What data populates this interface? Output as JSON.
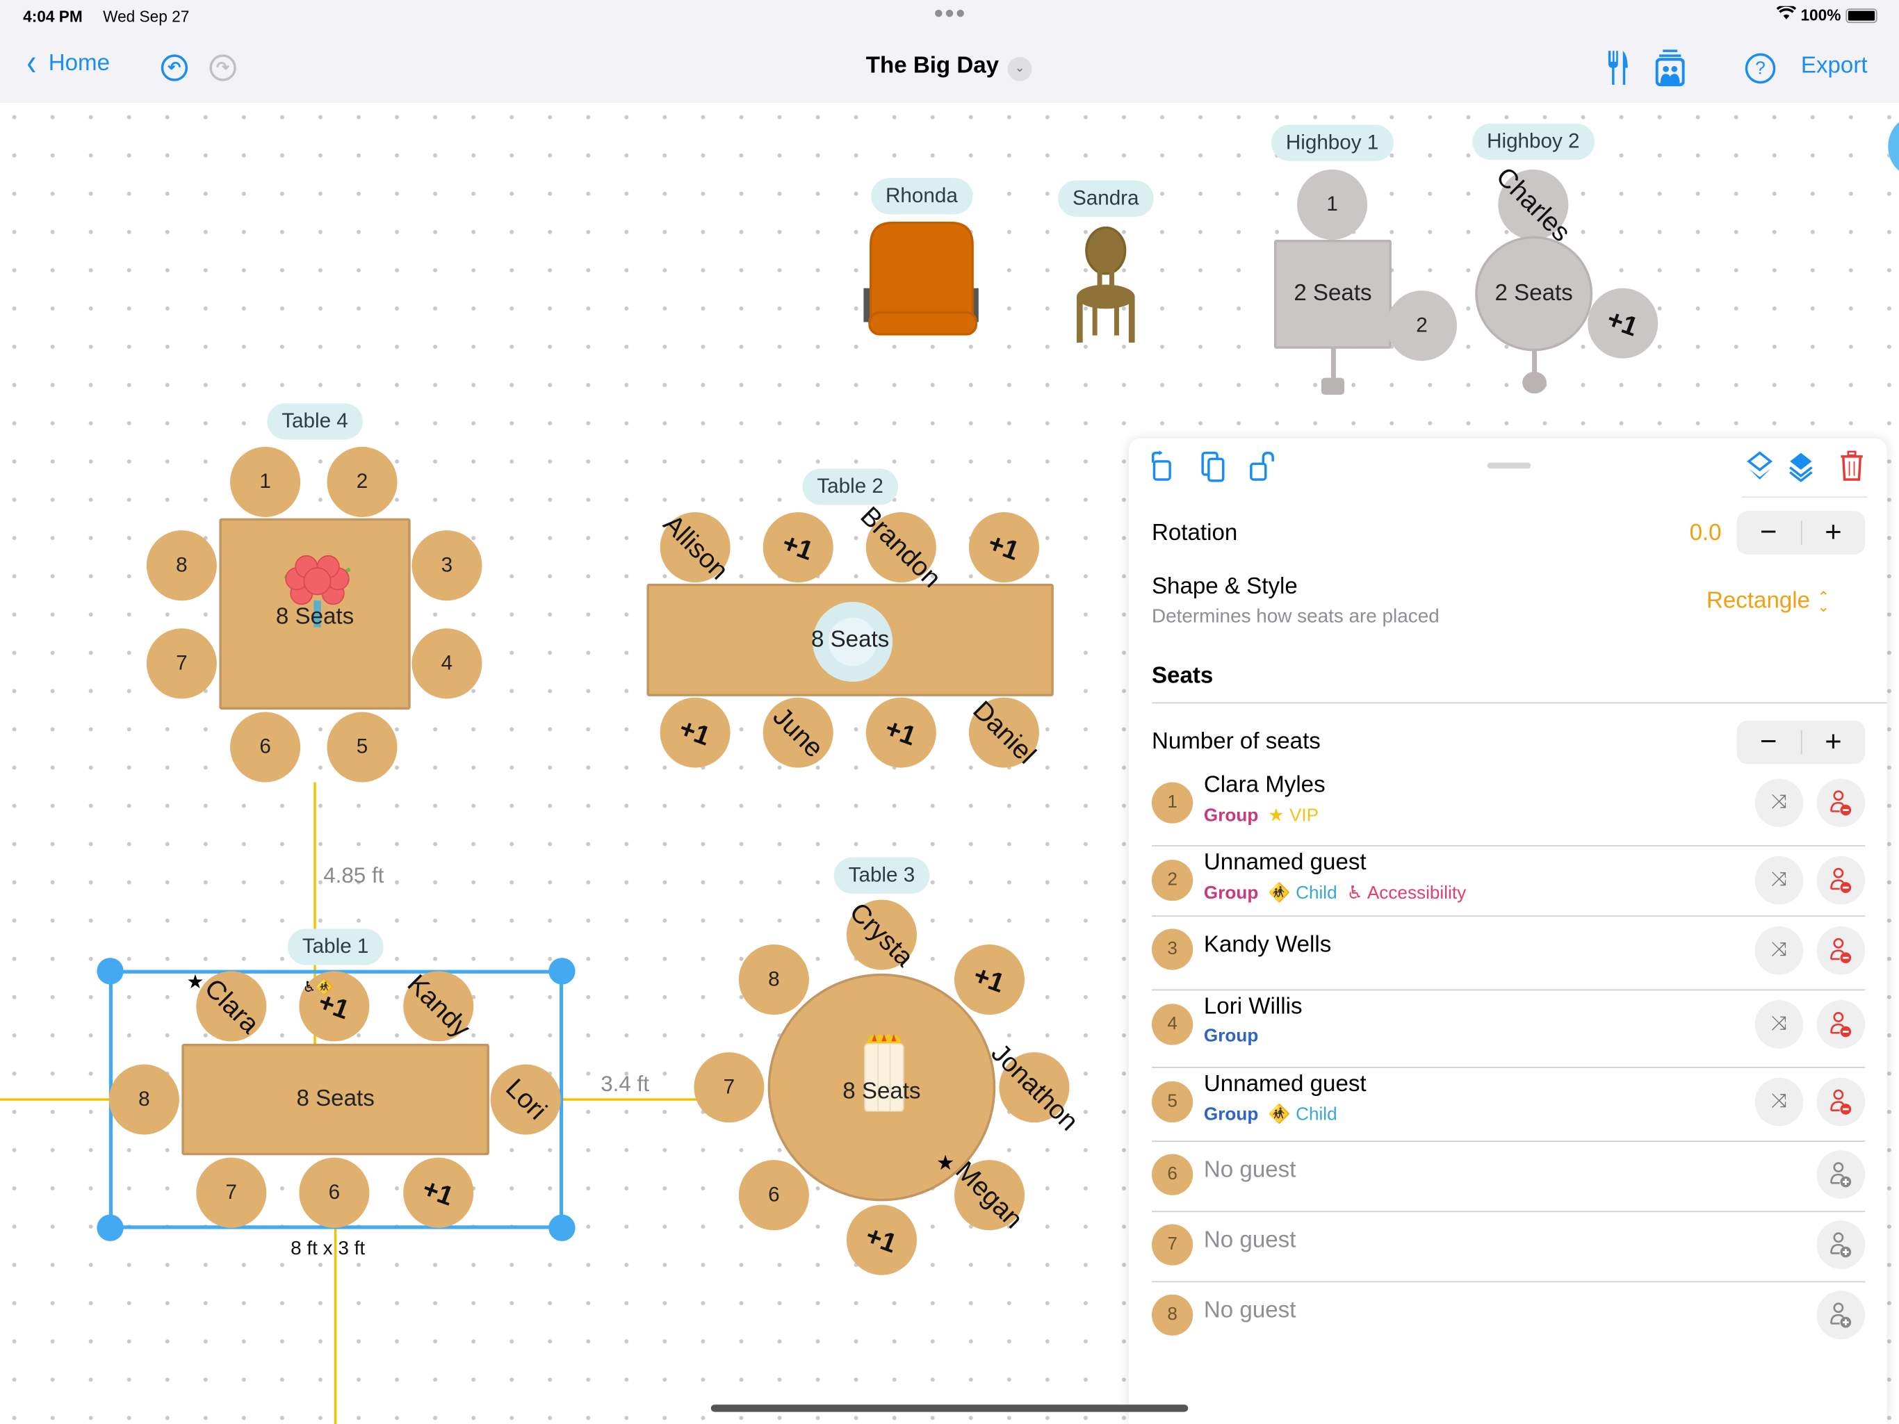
{
  "status_bar": {
    "time": "4:04 PM",
    "date": "Wed Sep 27",
    "battery": "100%"
  },
  "nav": {
    "back_label": "Home",
    "title": "The Big Day",
    "export_label": "Export",
    "icons": [
      "undo-icon",
      "redo-icon",
      "fork-knife-icon",
      "seating-chart-icon",
      "help-icon"
    ]
  },
  "canvas": {
    "objects": [
      {
        "type": "chair",
        "label": "Rhonda",
        "style": "armchair"
      },
      {
        "type": "chair",
        "label": "Sandra",
        "style": "dining-chair"
      },
      {
        "type": "highboy",
        "label": "Highboy 1",
        "center": "2 Seats",
        "shape": "square",
        "seats": [
          "1",
          "2"
        ]
      },
      {
        "type": "highboy",
        "label": "Highboy 2",
        "center": "2 Seats",
        "shape": "round",
        "seats": [
          "Charles",
          "+1"
        ]
      }
    ],
    "tables": [
      {
        "label": "Table 4",
        "center": "8 Seats",
        "shape": "square",
        "centerpiece": "flowers",
        "seats": [
          "1",
          "2",
          "3",
          "4",
          "5",
          "6",
          "7",
          "8"
        ]
      },
      {
        "label": "Table 2",
        "center": "8 Seats",
        "shape": "rectangle",
        "centerpiece": "plate",
        "seats": [
          "Allison",
          "+1",
          "Brandon",
          "+1",
          "Daniel",
          "+1",
          "June",
          "+1"
        ]
      },
      {
        "label": "Table 3",
        "center": "8 Seats",
        "shape": "round",
        "centerpiece": "candles",
        "seats": [
          "Crysta",
          "+1",
          "Jonathon",
          "Megan",
          "+1",
          "6",
          "7",
          "8"
        ]
      },
      {
        "label": "Table 1",
        "center": "8 Seats",
        "shape": "rectangle",
        "selected": true,
        "dimensions": "8 ft x 3 ft",
        "seats": [
          "Clara",
          "+1",
          "Kandy",
          "Lori",
          "+1",
          "6",
          "7",
          "8"
        ]
      }
    ],
    "measurements": {
      "vertical": "4.85 ft",
      "horizontal": "3.4 ft"
    }
  },
  "panel": {
    "toolbar_icons": [
      "rotate-icon",
      "duplicate-icon",
      "unlock-icon",
      "send-backward-icon",
      "bring-forward-icon",
      "trash-icon"
    ],
    "rotation_label": "Rotation",
    "rotation_value": "0.0",
    "shape_label": "Shape & Style",
    "shape_desc": "Determines how seats are placed",
    "shape_value": "Rectangle",
    "seats_header": "Seats",
    "num_seats_label": "Number of seats",
    "minus": "−",
    "plus": "+",
    "guests": [
      {
        "num": "1",
        "name": "Clara Myles",
        "tags": [
          {
            "text": "Group",
            "kind": "group-pink"
          },
          {
            "text": "VIP",
            "kind": "vip"
          }
        ],
        "assigned": true
      },
      {
        "num": "2",
        "name": "Unnamed guest",
        "tags": [
          {
            "text": "Group",
            "kind": "group-pink"
          },
          {
            "text": "Child",
            "kind": "child"
          },
          {
            "text": "Accessibility",
            "kind": "access"
          }
        ],
        "assigned": true
      },
      {
        "num": "3",
        "name": "Kandy Wells",
        "tags": [],
        "assigned": true
      },
      {
        "num": "4",
        "name": "Lori Willis",
        "tags": [
          {
            "text": "Group",
            "kind": "group-blue"
          }
        ],
        "assigned": true
      },
      {
        "num": "5",
        "name": "Unnamed guest",
        "tags": [
          {
            "text": "Group",
            "kind": "group-blue"
          },
          {
            "text": "Child",
            "kind": "child"
          }
        ],
        "assigned": true
      },
      {
        "num": "6",
        "name": "No guest",
        "tags": [],
        "assigned": false
      },
      {
        "num": "7",
        "name": "No guest",
        "tags": [],
        "assigned": false
      },
      {
        "num": "8",
        "name": "No guest",
        "tags": [],
        "assigned": false
      }
    ]
  },
  "colors": {
    "accent": "#1a8ef0",
    "seat": "#dfb06e",
    "highboy": "#cbc6c6",
    "chip": "#d9eff1",
    "guide": "#f2c300",
    "selection": "#43a9f0",
    "orange_value": "#f0a012",
    "group_pink": "#c83a7d",
    "group_blue": "#2e63c7",
    "vip": "#f3c316",
    "child": "#3aa6dd",
    "accessibility": "#e0406a",
    "remove_red": "#e53935"
  }
}
